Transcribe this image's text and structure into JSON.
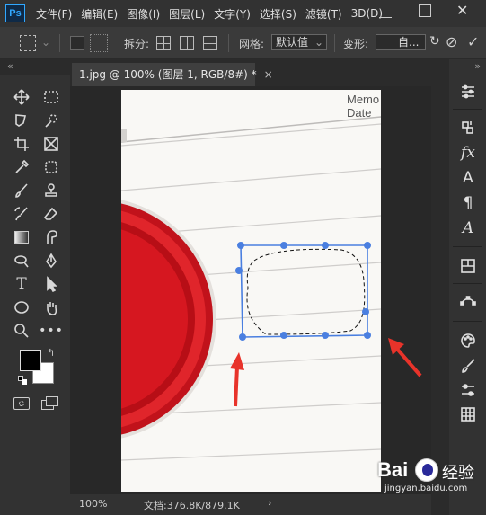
{
  "app": {
    "logo": "Ps"
  },
  "menu": [
    "文件(F)",
    "编辑(E)",
    "图像(I)",
    "图层(L)",
    "文字(Y)",
    "选择(S)",
    "滤镜(T)",
    "3D(D)"
  ],
  "options": {
    "split_label": "拆分:",
    "grid_label": "网格:",
    "grid_value": "默认值",
    "warp_label": "变形:",
    "warp_value": "自..."
  },
  "document": {
    "tab_title": "1.jpg @ 100% (图层 1, RGB/8#) *",
    "close": "×"
  },
  "photo_text": {
    "memo": "Memo",
    "date": "Date"
  },
  "status": {
    "zoom": "100%",
    "doc_info": "文档:376.8K/879.1K",
    "arrow": "›"
  },
  "right_panel": {
    "text_icon": "A",
    "paragraph_icon": "¶",
    "glyph_icon": "A",
    "fx_label": "fx"
  },
  "watermark": {
    "brand": "Bai",
    "brand_cn": "经验",
    "url": "jingyan.baidu.com"
  },
  "colors": {
    "selection": "#4a7fe0",
    "arrow": "#e8332a",
    "stamp_red": "#d9101a",
    "accent": "#31a8ff"
  },
  "icons": {
    "left_tools": [
      "move-icon",
      "marquee-icon",
      "lasso-icon",
      "quick-select-icon",
      "crop-icon",
      "frame-icon",
      "eyedropper-icon",
      "spot-heal-icon",
      "brush-icon",
      "clone-stamp-icon",
      "history-brush-icon",
      "eraser-icon",
      "gradient-icon",
      "smudge-icon",
      "dodge-icon",
      "pen-icon",
      "type-icon",
      "path-select-icon",
      "ellipse-icon",
      "hand-icon",
      "zoom-icon",
      "more-tools-icon"
    ]
  }
}
